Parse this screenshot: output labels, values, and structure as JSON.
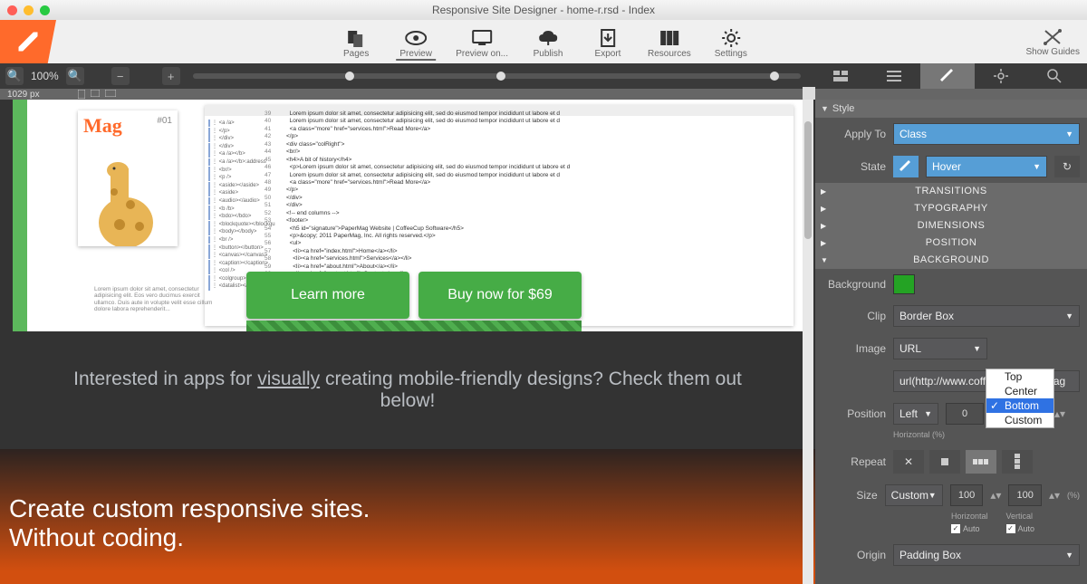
{
  "window": {
    "title": "Responsive Site Designer - home-r.rsd - Index"
  },
  "toolbar": {
    "items": [
      {
        "label": "Pages"
      },
      {
        "label": "Preview"
      },
      {
        "label": "Preview on..."
      },
      {
        "label": "Publish"
      },
      {
        "label": "Export"
      },
      {
        "label": "Resources"
      },
      {
        "label": "Settings"
      }
    ],
    "show_guides": "Show Guides"
  },
  "zoom": {
    "percent": "100%",
    "px_label": "1029 px"
  },
  "canvas": {
    "mag": {
      "title": "Mag",
      "issue": "#01"
    },
    "lorem": "Lorem ipsum dolor sit amet, consectetur adipisicing elit. Eos vero ducimus exercit ullamco. Duis aute in volupte velit esse cillum dolore labora reprehenderit...",
    "cta_learn": "Learn more",
    "cta_buy": "Buy now for $69",
    "dark_line1": "Interested in apps for ",
    "dark_underline": "visually",
    "dark_line2": " creating mobile-friendly designs? Check them out below!",
    "hero1": "Create custom responsive sites.",
    "hero2": "Without coding.",
    "code_lines": "  Lorem ipsum dolor sit amet, consectetur adipisicing elit, sed do eiusmod tempor incididunt ut labore et d\n  Lorem ipsum dolor sit amet, consectetur adipisicing elit, sed do eiusmod tempor incididunt ut labore et d\n  <a class=\"more\" href=\"services.html\">Read More</a>\n</p>\n<div class=\"colRight\">\n<br/>\n<h4>A bit of history</h4>\n  <p>Lorem ipsum dolor sit amet, consectetur adipisicing elit, sed do eiusmod tempor incididunt ut labore et d\n  Lorem ipsum dolor sit amet, consectetur adipisicing elit, sed do eiusmod tempor incididunt ut labore et d\n  <a class=\"more\" href=\"services.html\">Read More</a>\n</p>\n</div>\n</div>\n<!-- end columns -->\n<footer>\n  <h5 id=\"signature\">PaperMag Website | CoffeeCup Software</h5>\n  <p>&copy; 2011 PaperMag, Inc. All rights reserved.</p>\n  <ul>\n    <li><a href=\"index.html\">Home</a></li>\n    <li><a href=\"services.html\">Services</a></li>\n    <li><a href=\"about.html\">About</a></li>\n    <li><a href=\"contact.html\">Contact</a></li>\n  </ul>\n</footer>",
    "gutter": "39\n40\n41\n42\n43\n44\n45\n46\n47\n48\n49\n50\n51\n52\n53\n54\n55\n56\n57\n58\n59\n60\n61\n62",
    "tags": [
      "<a /a>",
      "</p>",
      "</div>",
      "</div>",
      "<a /a></b>",
      "<a /a></b>:address",
      "<br/>",
      "<p />",
      "<aside></aside>",
      "<aside>",
      "<audio></audio>",
      "<b /b>",
      "<bdo></bdo>",
      "<blockquote></blockqu",
      "<body></body>",
      "<br />",
      "<button></button>",
      "<canvas></canvas>",
      "<caption></caption>",
      "<col />",
      "<colgroup></colgroup>",
      "<datalist></datalist>"
    ]
  },
  "side": {
    "style_header": "Style",
    "apply_to": {
      "label": "Apply To",
      "value": "Class"
    },
    "state": {
      "label": "State",
      "value": "Hover"
    },
    "sections": [
      "TRANSITIONS",
      "TYPOGRAPHY",
      "DIMENSIONS",
      "POSITION",
      "BACKGROUND"
    ],
    "background": {
      "label": "Background",
      "clip": {
        "label": "Clip",
        "value": "Border Box"
      },
      "image": {
        "label": "Image",
        "value": "URL",
        "url": "url(http://www.coffeecup.com/imag"
      },
      "position": {
        "label": "Position",
        "horiz_sel": "Left",
        "horiz_val": "0",
        "vert_val": "00",
        "horiz_lab": "Horizontal (%)"
      },
      "options": [
        "Top",
        "Center",
        "Bottom",
        "Custom"
      ],
      "selected_option": "Bottom",
      "repeat": {
        "label": "Repeat"
      },
      "size": {
        "label": "Size",
        "value": "Custom",
        "h": "100",
        "v": "100",
        "unit": "(%)",
        "hlab": "Horizontal",
        "vlab": "Vertical",
        "auto": "Auto"
      },
      "origin": {
        "label": "Origin",
        "value": "Padding Box"
      }
    }
  }
}
